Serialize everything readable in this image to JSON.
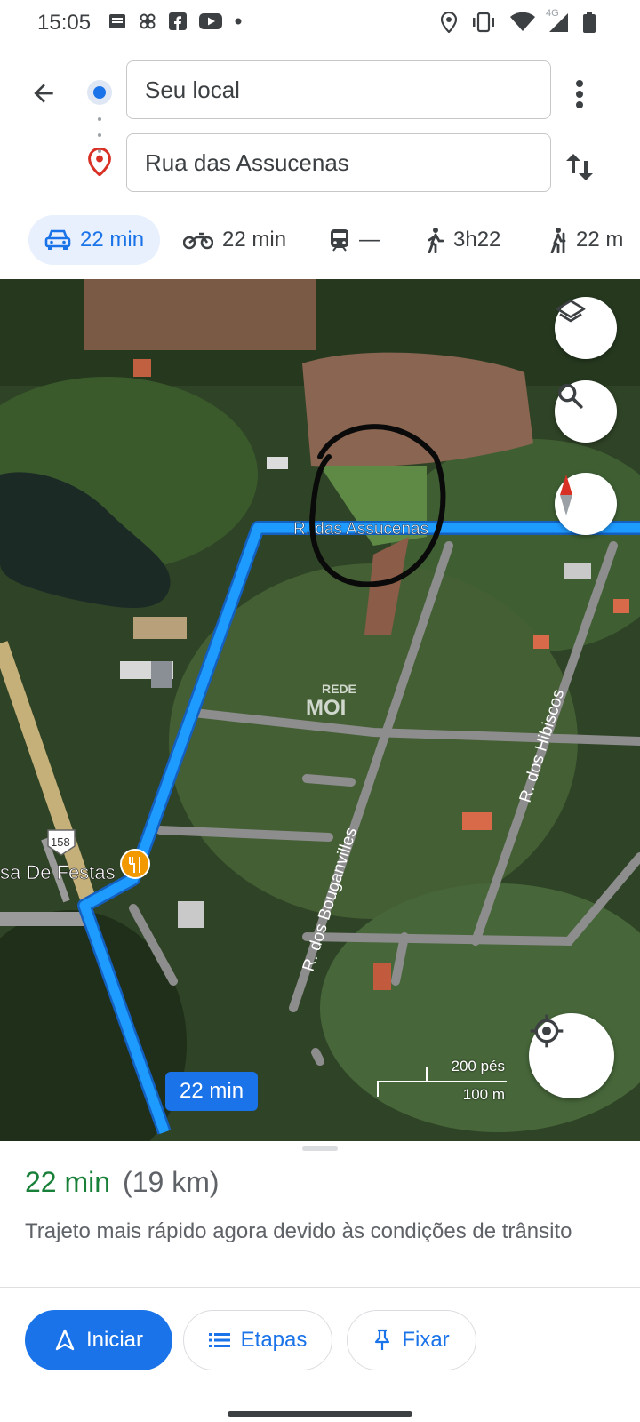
{
  "status_bar": {
    "time": "15:05",
    "network": "4G"
  },
  "directions": {
    "origin": "Seu local",
    "destination": "Rua das Assucenas"
  },
  "modes": [
    {
      "icon": "car-icon",
      "label": "22 min",
      "active": true
    },
    {
      "icon": "motorcycle-icon",
      "label": "22 min",
      "active": false
    },
    {
      "icon": "transit-icon",
      "label": "—",
      "active": false
    },
    {
      "icon": "walk-icon",
      "label": "3h22",
      "active": false
    },
    {
      "icon": "ride-icon",
      "label": "22 m",
      "active": false
    }
  ],
  "map": {
    "labels": {
      "street_assucenas": "R. das Assucenas",
      "street_hibiscos": "R. dos Hibiscos",
      "street_bouganvilles": "R. dos Bouganvilles",
      "place": "sa De Festas",
      "route_shield": "158",
      "watermark_top": "REDE",
      "watermark_bottom": "MOI"
    },
    "scale": {
      "imperial": "200 pés",
      "metric": "100 m"
    },
    "duration_chip": "22 min"
  },
  "sheet": {
    "duration": "22 min",
    "distance": "(19 km)",
    "description": "Trajeto mais rápido agora devido às condições de trânsito",
    "buttons": {
      "start": "Iniciar",
      "steps": "Etapas",
      "pin": "Fixar"
    }
  },
  "colors": {
    "accent": "#1a73e8",
    "route": "#1e9bff",
    "duration_green": "#188038"
  }
}
